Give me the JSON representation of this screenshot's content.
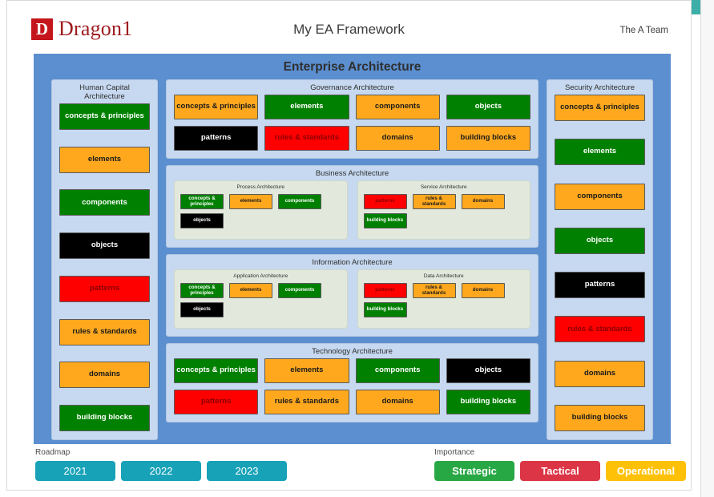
{
  "header": {
    "logo_mark": "D",
    "logo_text": "Dragon1",
    "title": "My EA Framework",
    "team": "The A Team"
  },
  "canvas": {
    "title": "Enterprise Architecture"
  },
  "colors": {
    "canvas_blue": "#5b8fd0",
    "panel_blue": "#c6d9f0",
    "subpanel_green": "#e2e9dc",
    "green": "#008000",
    "orange": "#ffa81e",
    "black": "#000000",
    "red": "#ff0000",
    "brand_red": "#c4161c",
    "teal": "#17a2b8"
  },
  "human_capital": {
    "title": "Human Capital Architecture",
    "boxes": [
      {
        "label": "concepts & principles",
        "color": "green"
      },
      {
        "label": "elements",
        "color": "orange"
      },
      {
        "label": "components",
        "color": "green"
      },
      {
        "label": "objects",
        "color": "black"
      },
      {
        "label": "patterns",
        "color": "red"
      },
      {
        "label": "rules & standards",
        "color": "orange"
      },
      {
        "label": "domains",
        "color": "orange"
      },
      {
        "label": "building blocks",
        "color": "green"
      }
    ]
  },
  "security": {
    "title": "Security Architecture",
    "boxes": [
      {
        "label": "concepts & principles",
        "color": "orange"
      },
      {
        "label": "elements",
        "color": "green"
      },
      {
        "label": "components",
        "color": "orange"
      },
      {
        "label": "objects",
        "color": "green"
      },
      {
        "label": "patterns",
        "color": "black"
      },
      {
        "label": "rules & standards",
        "color": "red"
      },
      {
        "label": "domains",
        "color": "orange"
      },
      {
        "label": "building blocks",
        "color": "orange"
      }
    ]
  },
  "governance": {
    "title": "Governance Architecture",
    "boxes": [
      {
        "label": "concepts & principles",
        "color": "orange"
      },
      {
        "label": "elements",
        "color": "green"
      },
      {
        "label": "components",
        "color": "orange"
      },
      {
        "label": "objects",
        "color": "green"
      },
      {
        "label": "patterns",
        "color": "black"
      },
      {
        "label": "rules & standards",
        "color": "red"
      },
      {
        "label": "domains",
        "color": "orange"
      },
      {
        "label": "building blocks",
        "color": "orange"
      }
    ]
  },
  "technology": {
    "title": "Technology Architecture",
    "boxes": [
      {
        "label": "concepts & principles",
        "color": "green"
      },
      {
        "label": "elements",
        "color": "orange"
      },
      {
        "label": "components",
        "color": "green"
      },
      {
        "label": "objects",
        "color": "black"
      },
      {
        "label": "patterns",
        "color": "red"
      },
      {
        "label": "rules & standards",
        "color": "orange"
      },
      {
        "label": "domains",
        "color": "orange"
      },
      {
        "label": "building blocks",
        "color": "green"
      }
    ]
  },
  "business": {
    "title": "Business Architecture",
    "subpanels": [
      {
        "title": "Process Architecture",
        "boxes": [
          {
            "label": "concepts & principles",
            "color": "green"
          },
          {
            "label": "elements",
            "color": "orange"
          },
          {
            "label": "components",
            "color": "green"
          },
          {
            "label": "objects",
            "color": "black"
          }
        ]
      },
      {
        "title": "Service Architecture",
        "boxes": [
          {
            "label": "patterns",
            "color": "red"
          },
          {
            "label": "rules & standards",
            "color": "orange"
          },
          {
            "label": "domains",
            "color": "orange"
          },
          {
            "label": "building blocks",
            "color": "green"
          }
        ]
      }
    ]
  },
  "information": {
    "title": "Information Architecture",
    "subpanels": [
      {
        "title": "Application Architecture",
        "boxes": [
          {
            "label": "concepts & principles",
            "color": "green"
          },
          {
            "label": "elements",
            "color": "orange"
          },
          {
            "label": "components",
            "color": "green"
          },
          {
            "label": "objects",
            "color": "black"
          }
        ]
      },
      {
        "title": "Data Architecture",
        "boxes": [
          {
            "label": "patterns",
            "color": "red"
          },
          {
            "label": "rules & standards",
            "color": "orange"
          },
          {
            "label": "domains",
            "color": "orange"
          },
          {
            "label": "building blocks",
            "color": "green"
          }
        ]
      }
    ]
  },
  "legend": {
    "roadmap": {
      "label": "Roadmap",
      "items": [
        "2021",
        "2022",
        "2023"
      ]
    },
    "importance": {
      "label": "Importance",
      "items": [
        "Strategic",
        "Tactical",
        "Operational"
      ]
    }
  }
}
